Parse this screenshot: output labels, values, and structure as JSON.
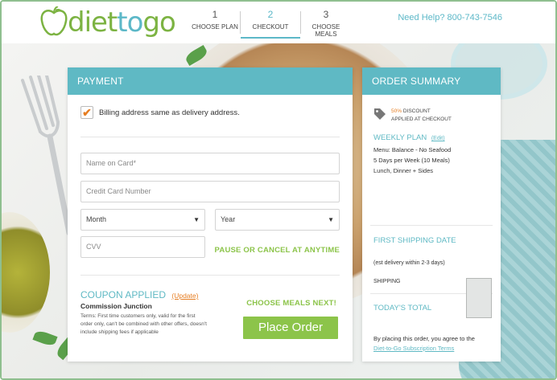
{
  "header": {
    "logo": {
      "part1": "diet",
      "part2": "to",
      "part3": "go"
    },
    "steps": [
      {
        "num": "1",
        "label": "CHOOSE PLAN"
      },
      {
        "num": "2",
        "label": "CHECKOUT"
      },
      {
        "num": "3",
        "label": "CHOOSE MEALS"
      }
    ],
    "help": "Need Help? 800-743-7546"
  },
  "payment": {
    "title": "PAYMENT",
    "billing_label": "Billing address same as delivery address.",
    "name_placeholder": "Name on Card*",
    "card_placeholder": "Credit Card Number",
    "month_label": "Month",
    "year_label": "Year",
    "cvv_placeholder": "CVV",
    "pause_text": "PAUSE OR CANCEL AT ANYTIME",
    "coupon_title": "COUPON APPLIED",
    "coupon_update": "(Update)",
    "coupon_name": "Commission Junction",
    "coupon_terms": "Terms: First time customers only, valid for the first order only, can't be combined with other offers, doesn't include shipping fees if applicable",
    "choose_next": "CHOOSE MEALS NEXT!",
    "place_order": "Place Order"
  },
  "summary": {
    "title": "ORDER SUMMARY",
    "discount_pct": "50%",
    "discount_word": "DISCOUNT",
    "discount_applied": "APPLIED AT CHECKOUT",
    "weekly_plan": "WEEKLY PLAN",
    "weekly_edit": "(Edit)",
    "menu_lines": [
      "Menu: Balance - No Seafood",
      "5 Days per Week (10 Meals)",
      "Lunch, Dinner + Sides"
    ],
    "first_shipping": "FIRST SHIPPING DATE",
    "est_delivery": "(est delivery within 2-3 days)",
    "shipping": "SHIPPING",
    "todays_total": "TODAY'S TOTAL",
    "agree_text": "By placing this order, you agree to the",
    "agree_link": "Diet-to-Go Subscription Terms"
  }
}
